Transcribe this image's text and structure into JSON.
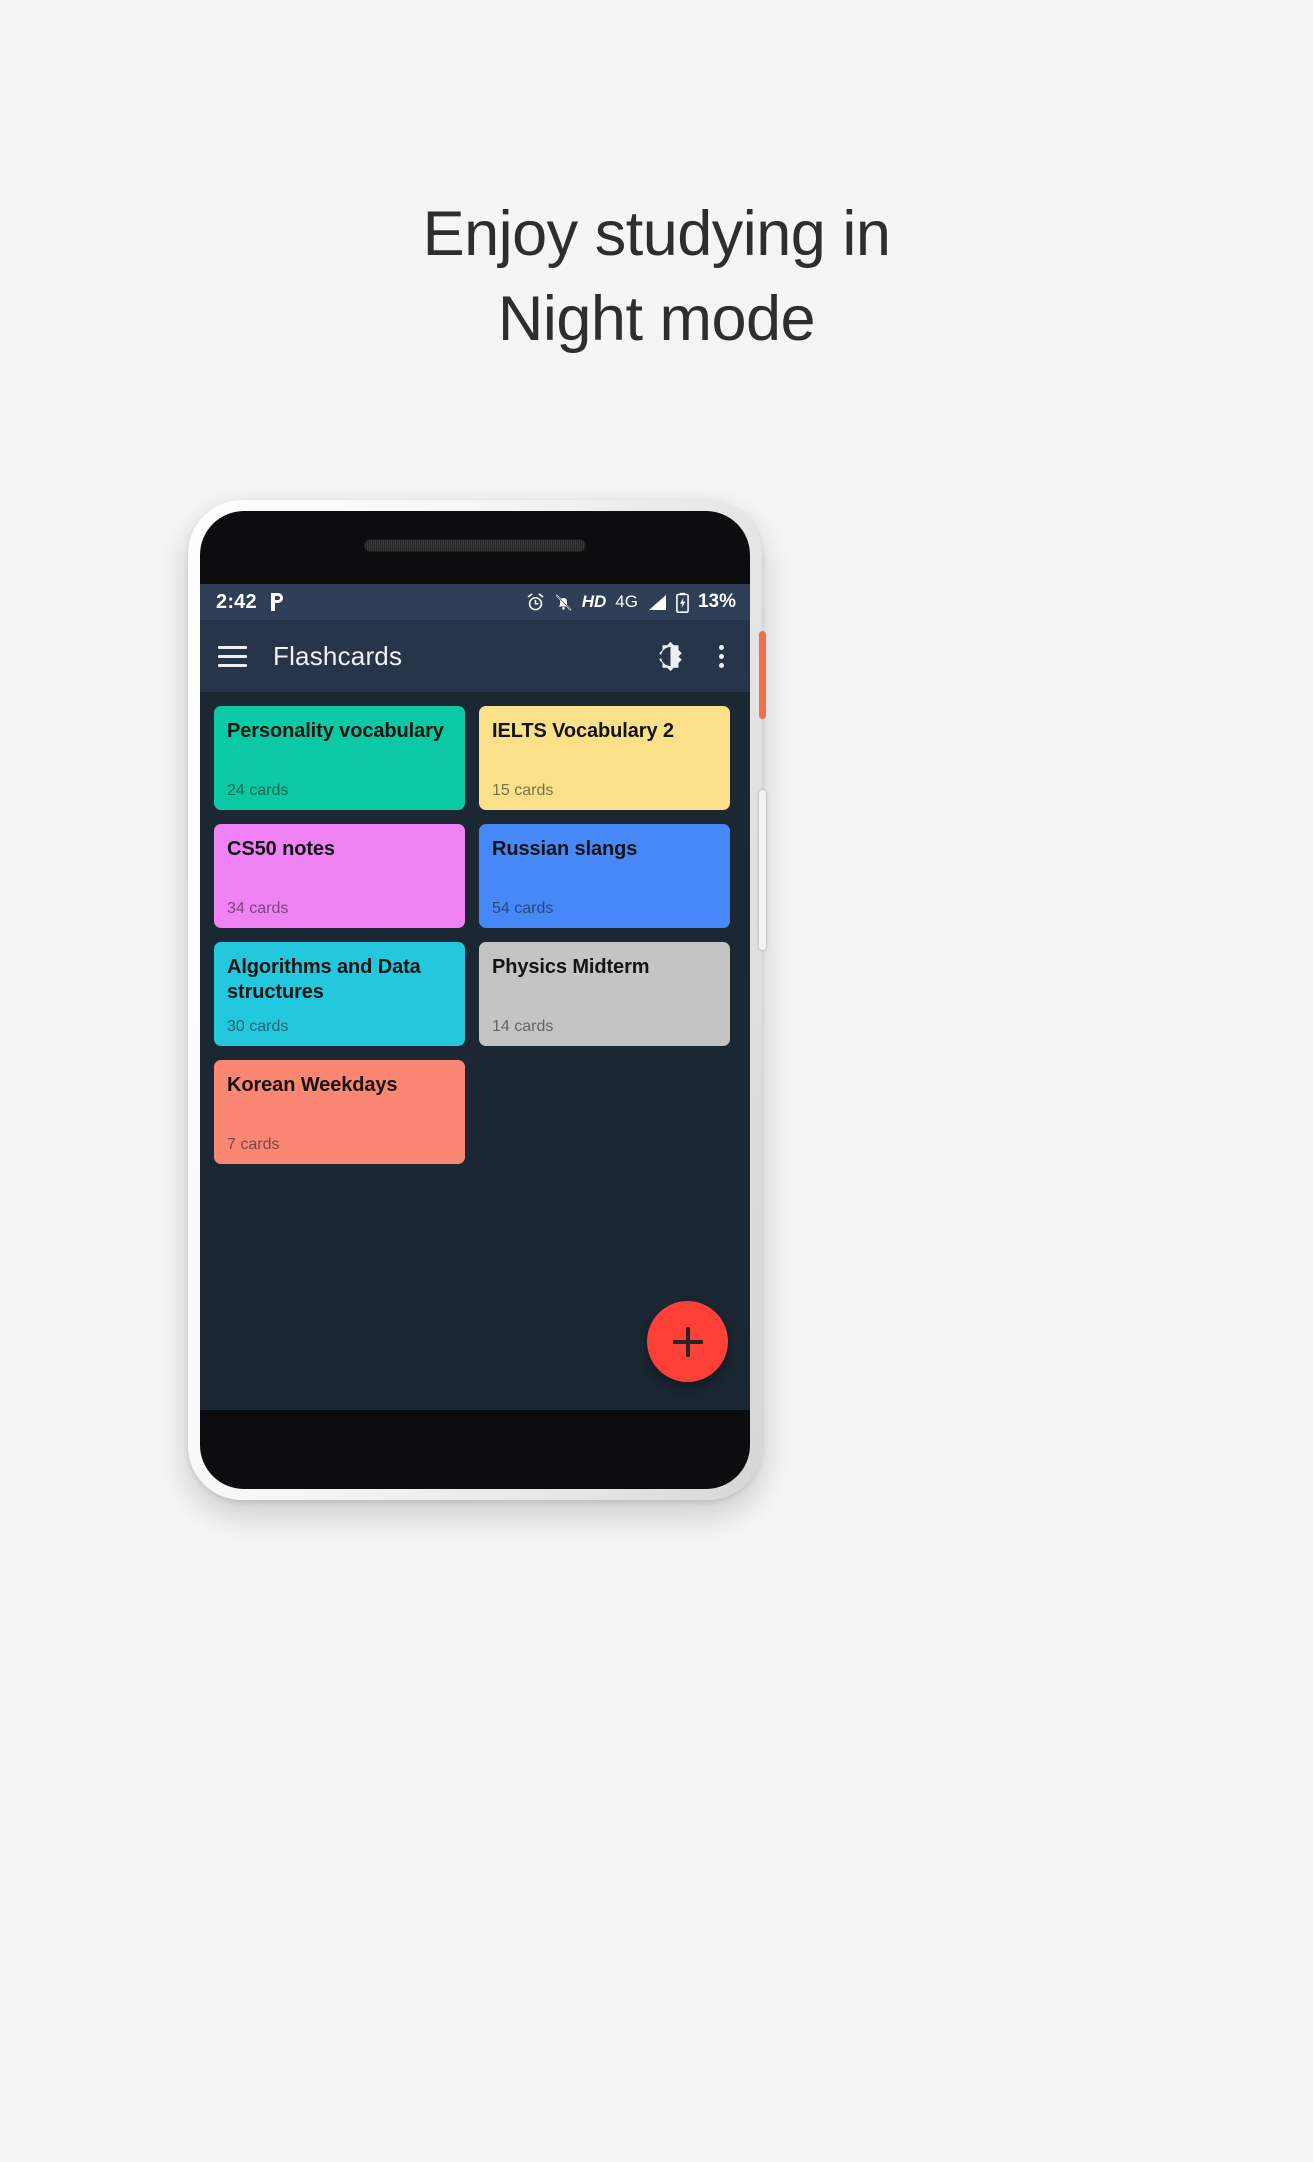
{
  "headline": {
    "line1": "Enjoy studying in",
    "line2": "Night mode"
  },
  "colors": {
    "page_background": "#f5f5f5",
    "headline_text": "#2e2e2e",
    "screen_background": "#1b2733",
    "statusbar_background": "#2f3f57",
    "appbar_background": "#26354a",
    "fab_background": "#ff4036",
    "fab_icon": "#2a2326",
    "power_button": "#ef6f4b"
  },
  "status_bar": {
    "time": "2:42",
    "carrier_icon": "p-logo-icon",
    "icons": [
      "alarm-clock-icon",
      "bell-muted-icon"
    ],
    "hd_label": "HD",
    "network_label": "4G",
    "signal_icon": "signal-bars-icon",
    "battery_icon": "battery-charging-icon",
    "battery_percent": "13%"
  },
  "app_bar": {
    "menu_icon": "hamburger-menu-icon",
    "title": "Flashcards",
    "night_mode_icon": "brightness-contrast-icon",
    "overflow_icon": "more-vertical-icon"
  },
  "decks": [
    {
      "title": "Personality vocabulary",
      "count": "24 cards",
      "color": "#0bc9a4",
      "text_color": "#10261f"
    },
    {
      "title": "IELTS Vocabulary 2",
      "count": "15 cards",
      "color": "#fae089",
      "text_color": "#2a2410"
    },
    {
      "title": "CS50 notes",
      "count": "34 cards",
      "color": "#ef82f5",
      "text_color": "#2b102d"
    },
    {
      "title": "Russian slangs",
      "count": "54 cards",
      "color": "#4688f8",
      "text_color": "#0f1c33"
    },
    {
      "title": "Algorithms and Data structures",
      "count": "30 cards",
      "color": "#23c7de",
      "text_color": "#0c2a2f"
    },
    {
      "title": "Physics Midterm",
      "count": "14 cards",
      "color": "#c4c4c4",
      "text_color": "#1c1c1c"
    },
    {
      "title": "Korean Weekdays",
      "count": "7 cards",
      "color": "#fa8673",
      "text_color": "#2e1410"
    }
  ],
  "fab": {
    "label": "+",
    "icon": "plus-icon"
  }
}
